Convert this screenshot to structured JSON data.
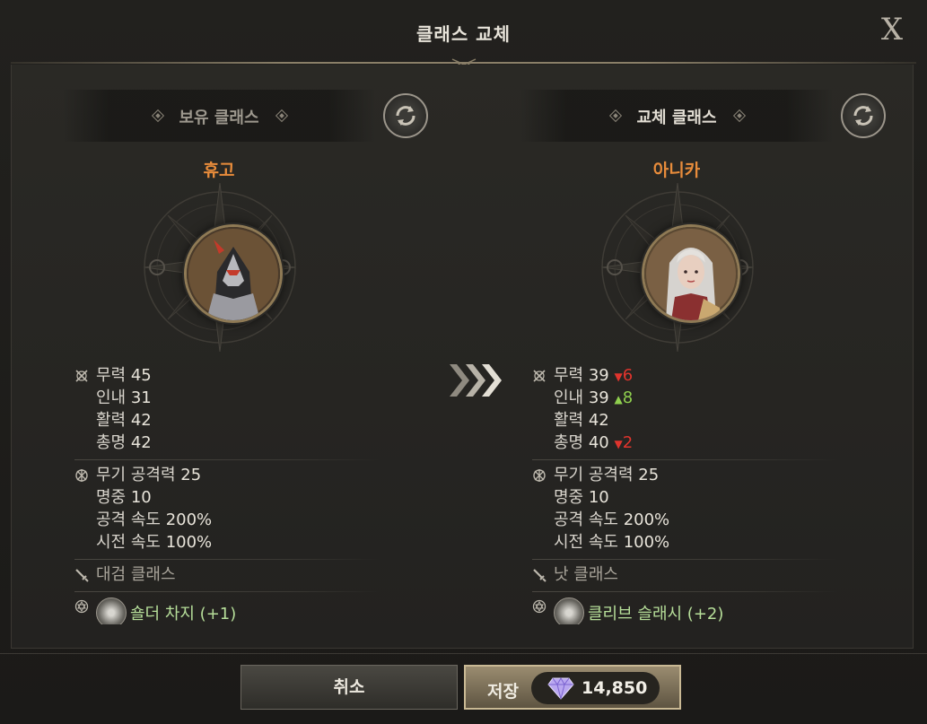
{
  "window": {
    "title": "클래스 교체",
    "close_label": "X"
  },
  "left_panel": {
    "header": "보유 클래스",
    "character_name": "휴고",
    "stats_primary": [
      {
        "label": "무력",
        "value": "45"
      },
      {
        "label": "인내",
        "value": "31"
      },
      {
        "label": "활력",
        "value": "42"
      },
      {
        "label": "총명",
        "value": "42"
      }
    ],
    "stats_combat": [
      {
        "label": "무기 공격력",
        "value": "25"
      },
      {
        "label": "명중",
        "value": "10"
      },
      {
        "label": "공격 속도",
        "value": "200%"
      },
      {
        "label": "시전 속도",
        "value": "100%"
      }
    ],
    "class_type": "대검 클래스",
    "skill": "숄더 차지 (+1)"
  },
  "right_panel": {
    "header": "교체 클래스",
    "character_name": "아니카",
    "stats_primary": [
      {
        "label": "무력",
        "value": "39",
        "delta": "6",
        "direction": "down"
      },
      {
        "label": "인내",
        "value": "39",
        "delta": "8",
        "direction": "up"
      },
      {
        "label": "활력",
        "value": "42",
        "delta": "",
        "direction": ""
      },
      {
        "label": "총명",
        "value": "40",
        "delta": "2",
        "direction": "down"
      }
    ],
    "stats_combat": [
      {
        "label": "무기 공격력",
        "value": "25"
      },
      {
        "label": "명중",
        "value": "10"
      },
      {
        "label": "공격 속도",
        "value": "200%"
      },
      {
        "label": "시전 속도",
        "value": "100%"
      }
    ],
    "class_type": "낫 클래스",
    "skill": "클리브 슬래시 (+2)"
  },
  "footer": {
    "cancel_label": "취소",
    "save_label": "저장",
    "cost": "14,850"
  },
  "colors": {
    "name_orange": "#e88c3b",
    "delta_down": "#e0342d",
    "delta_up": "#8fcf4e",
    "skill_green": "#b7df9a"
  },
  "icons": [
    "close-icon",
    "refresh-icon",
    "stat-icon",
    "weapon-icon",
    "skill-set-icon",
    "arrow-right-icon",
    "gem-icon"
  ]
}
